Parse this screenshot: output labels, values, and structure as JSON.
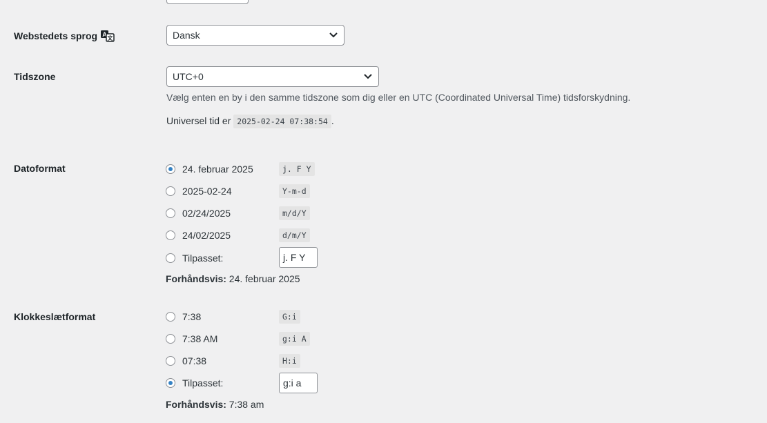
{
  "language": {
    "label": "Webstedets sprog",
    "icon": "translate-icon",
    "value": "Dansk"
  },
  "timezone": {
    "label": "Tidszone",
    "value": "UTC+0",
    "description": "Vælg enten en by i den samme tidszone som dig eller en UTC (Coordinated Universal Time) tidsforskydning.",
    "universal_prefix": "Universel tid er",
    "universal_value": "2025-02-24 07:38:54",
    "universal_suffix": "."
  },
  "date_format": {
    "label": "Datoformat",
    "options": [
      {
        "label": "24. februar 2025",
        "code": "j. F Y",
        "checked": true
      },
      {
        "label": "2025-02-24",
        "code": "Y-m-d",
        "checked": false
      },
      {
        "label": "02/24/2025",
        "code": "m/d/Y",
        "checked": false
      },
      {
        "label": "24/02/2025",
        "code": "d/m/Y",
        "checked": false
      }
    ],
    "custom_label": "Tilpasset:",
    "custom_value": "j. F Y",
    "custom_checked": false,
    "preview_label": "Forhåndsvis:",
    "preview_value": "24. februar 2025"
  },
  "time_format": {
    "label": "Klokkeslætformat",
    "options": [
      {
        "label": "7:38",
        "code": "G:i",
        "checked": false
      },
      {
        "label": "7:38 AM",
        "code": "g:i A",
        "checked": false
      },
      {
        "label": "07:38",
        "code": "H:i",
        "checked": false
      }
    ],
    "custom_label": "Tilpasset:",
    "custom_value": "g:i a",
    "custom_checked": true,
    "preview_label": "Forhåndsvis:",
    "preview_value": "7:38 am"
  },
  "colors": {
    "background": "#f0f0f1",
    "radio_checked": "#3582c4",
    "border": "#8c8f94"
  }
}
